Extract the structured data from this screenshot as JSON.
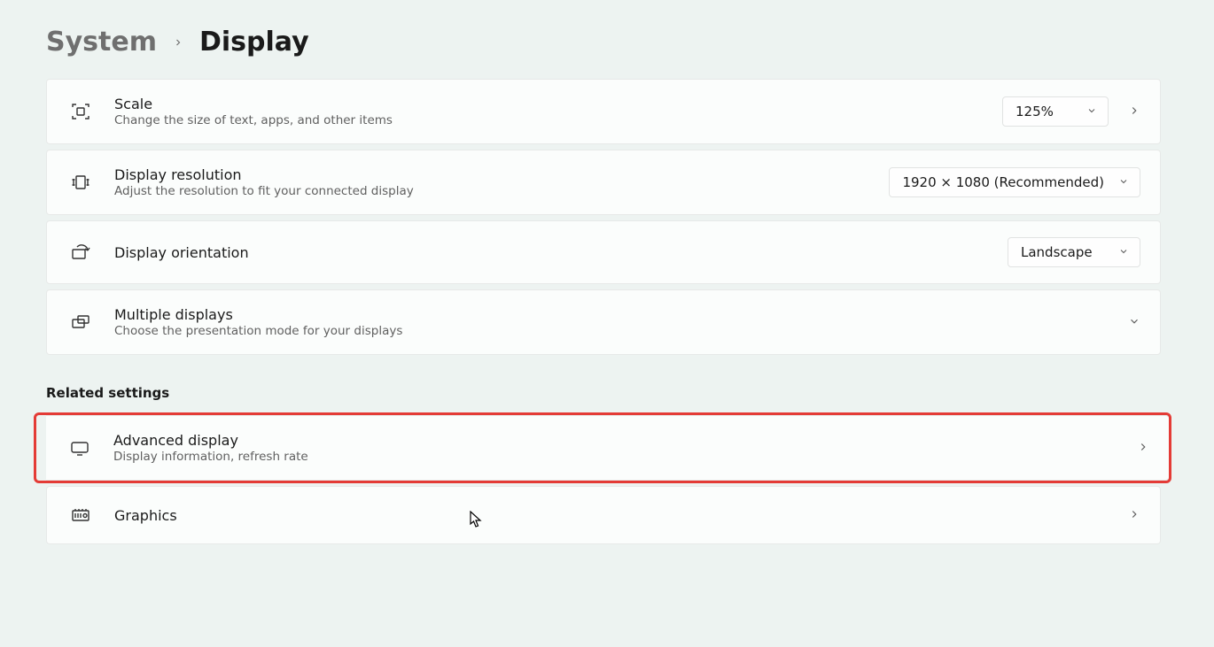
{
  "breadcrumb": {
    "parent": "System",
    "current": "Display"
  },
  "rows": {
    "scale": {
      "title": "Scale",
      "desc": "Change the size of text, apps, and other items",
      "value": "125%"
    },
    "resolution": {
      "title": "Display resolution",
      "desc": "Adjust the resolution to fit your connected display",
      "value": "1920 × 1080 (Recommended)"
    },
    "orientation": {
      "title": "Display orientation",
      "value": "Landscape"
    },
    "multiple": {
      "title": "Multiple displays",
      "desc": "Choose the presentation mode for your displays"
    },
    "advanced": {
      "title": "Advanced display",
      "desc": "Display information, refresh rate"
    },
    "graphics": {
      "title": "Graphics"
    }
  },
  "section_header": "Related settings"
}
